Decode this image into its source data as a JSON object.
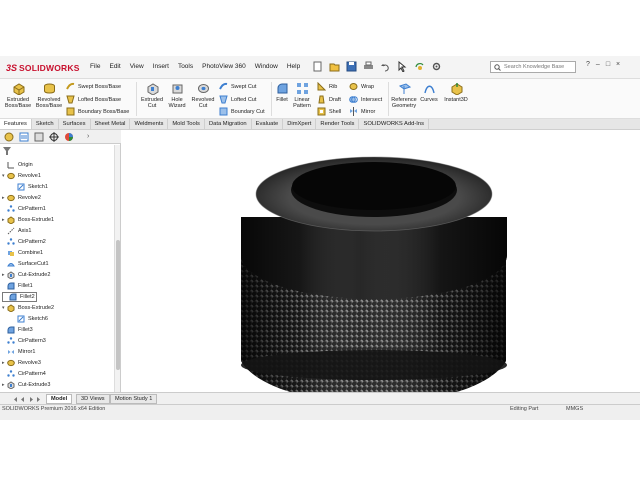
{
  "app": {
    "brand_mark": "3S",
    "brand_name": "SOLIDWORKS"
  },
  "menu": [
    "File",
    "Edit",
    "View",
    "Insert",
    "Tools",
    "PhotoView 360",
    "Window",
    "Help"
  ],
  "search": {
    "placeholder": "Search Knowledge Base"
  },
  "ribbon": {
    "extruded_boss": "Extruded Boss/Base",
    "revolved_boss": "Revolved Boss/Base",
    "swept_boss": "Swept Boss/Base",
    "lofted_boss": "Lofted Boss/Base",
    "boundary_boss": "Boundary Boss/Base",
    "extruded_cut": "Extruded Cut",
    "hole_wizard": "Hole Wizard",
    "revolved_cut": "Revolved Cut",
    "swept_cut": "Swept Cut",
    "lofted_cut": "Lofted Cut",
    "boundary_cut": "Boundary Cut",
    "fillet": "Fillet",
    "linear_pattern": "Linear Pattern",
    "rib": "Rib",
    "draft": "Draft",
    "shell": "Shell",
    "wrap": "Wrap",
    "intersect": "Intersect",
    "mirror": "Mirror",
    "reference_geometry": "Reference Geometry",
    "curves": "Curves",
    "instant3d": "Instant3D"
  },
  "tabs": [
    "Features",
    "Sketch",
    "Surfaces",
    "Sheet Metal",
    "Weldments",
    "Mold Tools",
    "Data Migration",
    "Evaluate",
    "DimXpert",
    "Render Tools",
    "SOLIDWORKS Add-Ins"
  ],
  "tree": [
    {
      "label": "Origin",
      "icon": "origin-icon",
      "expander": ""
    },
    {
      "label": "Revolve1",
      "icon": "revolve-icon",
      "expander": "▾"
    },
    {
      "label": "Sketch1",
      "icon": "sketch-icon",
      "expander": ""
    },
    {
      "label": "Revolve2",
      "icon": "revolve-icon",
      "expander": "▸"
    },
    {
      "label": "CirPattern1",
      "icon": "circular-pattern-icon",
      "expander": ""
    },
    {
      "label": "Boss-Extrude1",
      "icon": "extrude-icon",
      "expander": "▸"
    },
    {
      "label": "Axis1",
      "icon": "axis-icon",
      "expander": ""
    },
    {
      "label": "CirPattern2",
      "icon": "circular-pattern-icon",
      "expander": ""
    },
    {
      "label": "Combine1",
      "icon": "combine-icon",
      "expander": ""
    },
    {
      "label": "SurfaceCut1",
      "icon": "surface-cut-icon",
      "expander": ""
    },
    {
      "label": "Cut-Extrude2",
      "icon": "cut-extrude-icon",
      "expander": "▸"
    },
    {
      "label": "Fillet1",
      "icon": "fillet-icon",
      "expander": ""
    },
    {
      "label": "Fillet2",
      "icon": "fillet-icon",
      "expander": ""
    },
    {
      "label": "Boss-Extrude2",
      "icon": "extrude-icon",
      "expander": "▾"
    },
    {
      "label": "Sketch6",
      "icon": "sketch-icon",
      "expander": ""
    },
    {
      "label": "Fillet3",
      "icon": "fillet-icon",
      "expander": ""
    },
    {
      "label": "CirPattern3",
      "icon": "circular-pattern-icon",
      "expander": ""
    },
    {
      "label": "Mirror1",
      "icon": "mirror-icon",
      "expander": ""
    },
    {
      "label": "Revolve3",
      "icon": "revolve-icon",
      "expander": "▸"
    },
    {
      "label": "CirPattern4",
      "icon": "circular-pattern-icon",
      "expander": ""
    },
    {
      "label": "Cut-Extrude3",
      "icon": "cut-extrude-icon",
      "expander": "▸"
    }
  ],
  "bottom_tabs": [
    "Model",
    "3D Views",
    "Motion Study 1"
  ],
  "status": {
    "left": "SOLIDWORKS Premium 2016 x64 Edition",
    "mid": "Editing Part",
    "units": "MMGS"
  },
  "colors": {
    "brand": "#c8102e",
    "part": "#1e1e1e",
    "tree_icon": "#1f6fb5"
  }
}
